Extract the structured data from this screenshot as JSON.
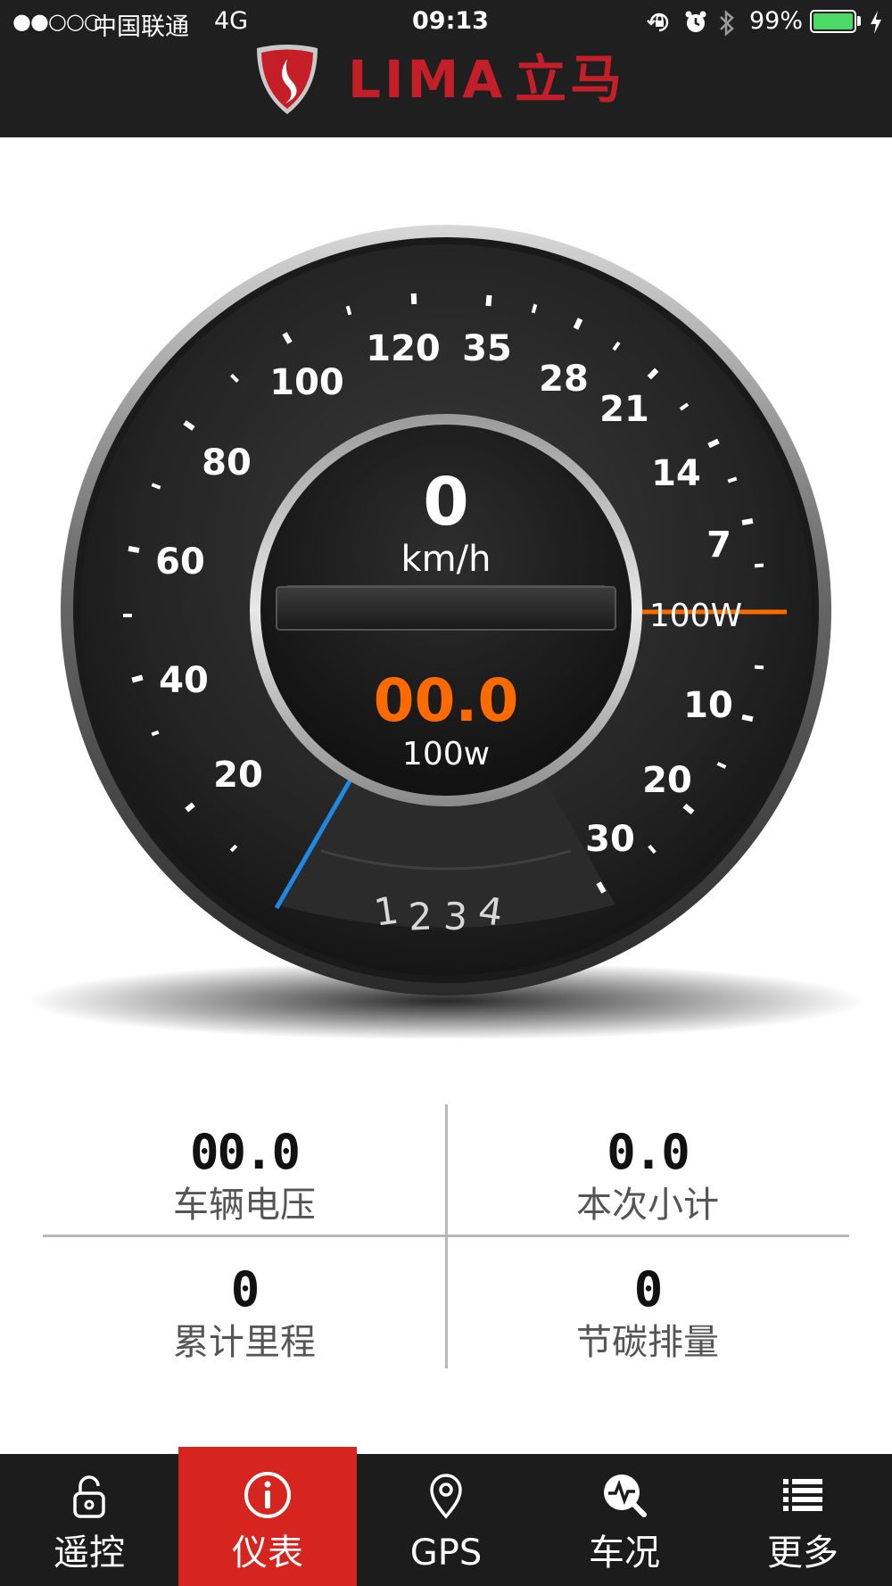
{
  "status_bar": {
    "signal": "●●○○○",
    "carrier": "中国联通",
    "network": "4G",
    "time": "09:13",
    "battery": "99%",
    "battery_level": 0.99
  },
  "header": {
    "brand_latin": "LIMA",
    "brand_cn": "立马"
  },
  "gauge": {
    "speed_value": "0",
    "speed_unit": "km/h",
    "power_value": "00.0",
    "power_unit": "100w",
    "power_marker_label": "100W",
    "gear_digits": [
      "1",
      "2",
      "3",
      "4"
    ],
    "left_scale_labels": [
      "20",
      "40",
      "60",
      "80",
      "100",
      "120"
    ],
    "right_upper_labels": [
      "35",
      "28",
      "21",
      "14",
      "7"
    ],
    "right_lower_labels": [
      "10",
      "20",
      "30"
    ],
    "accent_color": "#ff6a00",
    "needle_color": "#1e88e5"
  },
  "stats": [
    {
      "value": "00.0",
      "label": "车辆电压"
    },
    {
      "value": "0.0",
      "label": "本次小计"
    },
    {
      "value": "0",
      "label": "累计里程"
    },
    {
      "value": "0",
      "label": "节碳排量"
    }
  ],
  "tabbar": {
    "active_color": "#d6251e",
    "items": [
      {
        "label": "遥控",
        "icon": "lock-icon",
        "active": false
      },
      {
        "label": "仪表",
        "icon": "info-gauge-icon",
        "active": true
      },
      {
        "label": "GPS",
        "icon": "location-pin-icon",
        "active": false
      },
      {
        "label": "车况",
        "icon": "diagnostics-icon",
        "active": false
      },
      {
        "label": "更多",
        "icon": "list-icon",
        "active": false
      }
    ]
  }
}
